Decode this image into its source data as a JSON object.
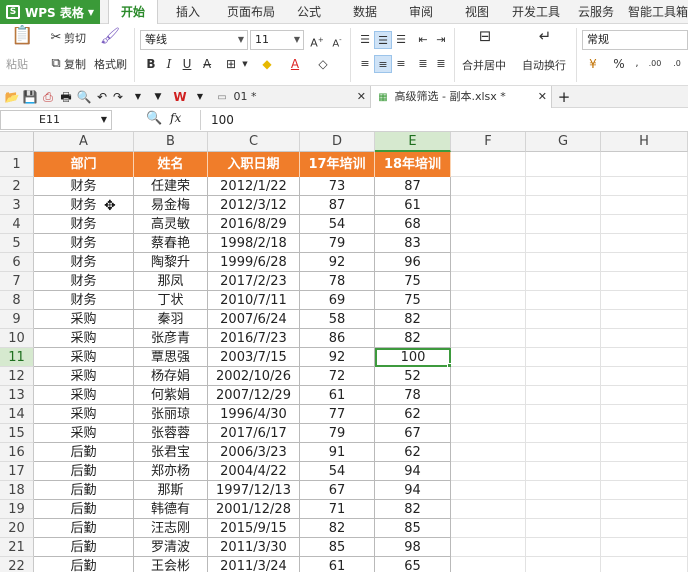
{
  "app": {
    "name": "WPS 表格"
  },
  "menu": {
    "tabs": [
      "开始",
      "插入",
      "页面布局",
      "公式",
      "数据",
      "审阅",
      "视图",
      "开发工具",
      "云服务",
      "智能工具箱"
    ],
    "active": "开始"
  },
  "ribbon": {
    "paste": "粘贴",
    "cut": "剪切",
    "copy": "复制",
    "format_painter": "格式刷",
    "font_name": "等线",
    "font_size": "11",
    "number_format": "常规",
    "merge_center": "合并居中",
    "wrap_text": "自动换行"
  },
  "doc_tabs": [
    {
      "label": "01 *",
      "active": false
    },
    {
      "label": "高级筛选 - 副本.xlsx *",
      "active": true
    }
  ],
  "formula_bar": {
    "cell_ref": "E11",
    "fx": "fx",
    "value": "100"
  },
  "sheet": {
    "columns": [
      "A",
      "B",
      "C",
      "D",
      "E",
      "F",
      "G",
      "H"
    ],
    "active_column": "E",
    "active_row": "11",
    "headers": [
      "部门",
      "姓名",
      "入职日期",
      "17年培训",
      "18年培训"
    ],
    "rows": [
      {
        "num": "2",
        "cells": [
          "财务",
          "任建荣",
          "2012/1/22",
          "73",
          "87"
        ]
      },
      {
        "num": "3",
        "cells": [
          "财务",
          "易金梅",
          "2012/3/12",
          "87",
          "61"
        ]
      },
      {
        "num": "4",
        "cells": [
          "财务",
          "高灵敏",
          "2016/8/29",
          "54",
          "68"
        ]
      },
      {
        "num": "5",
        "cells": [
          "财务",
          "蔡春艳",
          "1998/2/18",
          "79",
          "83"
        ]
      },
      {
        "num": "6",
        "cells": [
          "财务",
          "陶黎升",
          "1999/6/28",
          "92",
          "96"
        ]
      },
      {
        "num": "7",
        "cells": [
          "财务",
          "那凤",
          "2017/2/23",
          "78",
          "75"
        ]
      },
      {
        "num": "8",
        "cells": [
          "财务",
          "丁状",
          "2010/7/11",
          "69",
          "75"
        ]
      },
      {
        "num": "9",
        "cells": [
          "采购",
          "秦羽",
          "2007/6/24",
          "58",
          "82"
        ]
      },
      {
        "num": "10",
        "cells": [
          "采购",
          "张彦青",
          "2016/7/23",
          "86",
          "82"
        ]
      },
      {
        "num": "11",
        "cells": [
          "采购",
          "覃思强",
          "2003/7/15",
          "92",
          "100"
        ]
      },
      {
        "num": "12",
        "cells": [
          "采购",
          "杨存娟",
          "2002/10/26",
          "72",
          "52"
        ]
      },
      {
        "num": "13",
        "cells": [
          "采购",
          "何紫娟",
          "2007/12/29",
          "61",
          "78"
        ]
      },
      {
        "num": "14",
        "cells": [
          "采购",
          "张丽琼",
          "1996/4/30",
          "77",
          "62"
        ]
      },
      {
        "num": "15",
        "cells": [
          "采购",
          "张蓉蓉",
          "2017/6/17",
          "79",
          "67"
        ]
      },
      {
        "num": "16",
        "cells": [
          "后勤",
          "张君宝",
          "2006/3/23",
          "91",
          "62"
        ]
      },
      {
        "num": "17",
        "cells": [
          "后勤",
          "郑亦杨",
          "2004/4/22",
          "54",
          "94"
        ]
      },
      {
        "num": "18",
        "cells": [
          "后勤",
          "那斯",
          "1997/12/13",
          "67",
          "94"
        ]
      },
      {
        "num": "19",
        "cells": [
          "后勤",
          "韩德有",
          "2001/12/28",
          "71",
          "82"
        ]
      },
      {
        "num": "20",
        "cells": [
          "后勤",
          "汪志刚",
          "2015/9/15",
          "82",
          "85"
        ]
      },
      {
        "num": "21",
        "cells": [
          "后勤",
          "罗清波",
          "2011/3/30",
          "85",
          "98"
        ]
      },
      {
        "num": "22",
        "cells": [
          "后勤",
          "王会彬",
          "2011/3/24",
          "61",
          "65"
        ]
      }
    ]
  },
  "colors": {
    "accent_green": "#3a9a38",
    "header_orange": "#f07d2a",
    "selection_green": "#3d9a3d"
  }
}
